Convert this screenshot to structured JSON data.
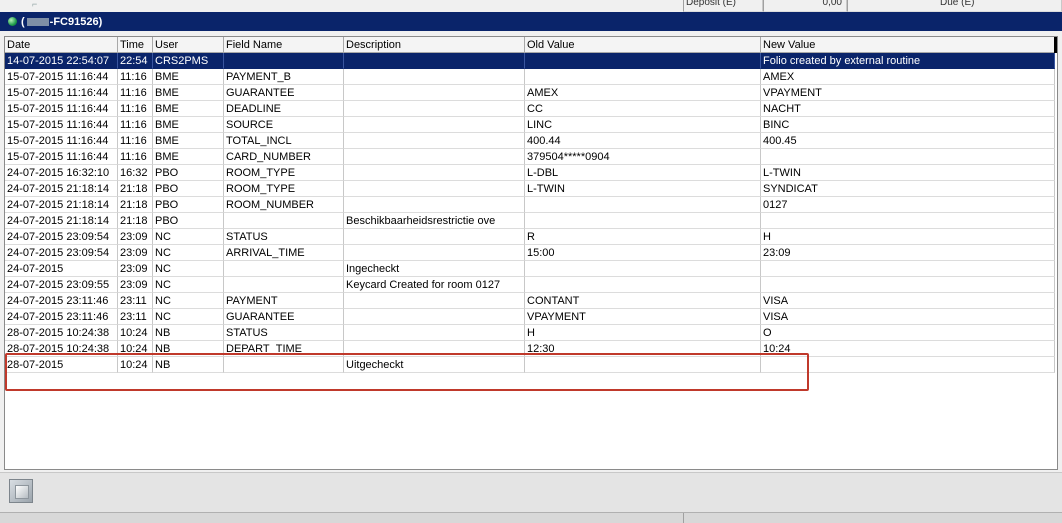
{
  "top_strip": {
    "cells": [
      "Deposit (E)",
      "0,00",
      "Due (E)"
    ]
  },
  "window": {
    "title_prefix": "(",
    "title_suffix": "-FC91526)"
  },
  "columns": {
    "date": "Date",
    "time": "Time",
    "user": "User",
    "field": "Field Name",
    "desc": "Description",
    "old": "Old Value",
    "new": "New Value"
  },
  "rows": [
    {
      "date": "14-07-2015 22:54:07",
      "time": "22:54",
      "user": "CRS2PMS",
      "field": "",
      "desc": "",
      "old": "",
      "new": "Folio created by external routine"
    },
    {
      "date": "15-07-2015 11:16:44",
      "time": "11:16",
      "user": "BME",
      "field": "PAYMENT_B",
      "desc": "",
      "old": "",
      "new": "AMEX"
    },
    {
      "date": "15-07-2015 11:16:44",
      "time": "11:16",
      "user": "BME",
      "field": "GUARANTEE",
      "desc": "",
      "old": "AMEX",
      "new": "VPAYMENT"
    },
    {
      "date": "15-07-2015 11:16:44",
      "time": "11:16",
      "user": "BME",
      "field": "DEADLINE",
      "desc": "",
      "old": "CC",
      "new": "NACHT"
    },
    {
      "date": "15-07-2015 11:16:44",
      "time": "11:16",
      "user": "BME",
      "field": "SOURCE",
      "desc": "",
      "old": "LINC",
      "new": "BINC"
    },
    {
      "date": "15-07-2015 11:16:44",
      "time": "11:16",
      "user": "BME",
      "field": "TOTAL_INCL",
      "desc": "",
      "old": "400.44",
      "new": "400.45"
    },
    {
      "date": "15-07-2015 11:16:44",
      "time": "11:16",
      "user": "BME",
      "field": "CARD_NUMBER",
      "desc": "",
      "old": "379504*****0904",
      "new": ""
    },
    {
      "date": "24-07-2015 16:32:10",
      "time": "16:32",
      "user": "PBO",
      "field": "ROOM_TYPE",
      "desc": "",
      "old": "L-DBL",
      "new": "L-TWIN"
    },
    {
      "date": "24-07-2015 21:18:14",
      "time": "21:18",
      "user": "PBO",
      "field": "ROOM_TYPE",
      "desc": "",
      "old": "L-TWIN",
      "new": "SYNDICAT"
    },
    {
      "date": "24-07-2015 21:18:14",
      "time": "21:18",
      "user": "PBO",
      "field": "ROOM_NUMBER",
      "desc": "",
      "old": "",
      "new": "0127"
    },
    {
      "date": "24-07-2015 21:18:14",
      "time": "21:18",
      "user": "PBO",
      "field": "",
      "desc": "Beschikbaarheidsrestrictie ove",
      "old": "",
      "new": ""
    },
    {
      "date": "24-07-2015 23:09:54",
      "time": "23:09",
      "user": "NC",
      "field": "STATUS",
      "desc": "",
      "old": "R",
      "new": "H"
    },
    {
      "date": "24-07-2015 23:09:54",
      "time": "23:09",
      "user": "NC",
      "field": "ARRIVAL_TIME",
      "desc": "",
      "old": "15:00",
      "new": "23:09"
    },
    {
      "date": "24-07-2015",
      "time": "23:09",
      "user": "NC",
      "field": "",
      "desc": "Ingecheckt",
      "old": "",
      "new": ""
    },
    {
      "date": "24-07-2015 23:09:55",
      "time": "23:09",
      "user": "NC",
      "field": "",
      "desc": "Keycard Created for room 0127",
      "old": "",
      "new": ""
    },
    {
      "date": "24-07-2015 23:11:46",
      "time": "23:11",
      "user": "NC",
      "field": "PAYMENT",
      "desc": "",
      "old": "CONTANT",
      "new": "VISA"
    },
    {
      "date": "24-07-2015 23:11:46",
      "time": "23:11",
      "user": "NC",
      "field": "GUARANTEE",
      "desc": "",
      "old": "VPAYMENT",
      "new": "VISA"
    },
    {
      "date": "28-07-2015 10:24:38",
      "time": "10:24",
      "user": "NB",
      "field": "STATUS",
      "desc": "",
      "old": "H",
      "new": "O"
    },
    {
      "date": "28-07-2015 10:24:38",
      "time": "10:24",
      "user": "NB",
      "field": "DEPART_TIME",
      "desc": "",
      "old": "12:30",
      "new": "10:24"
    },
    {
      "date": "28-07-2015",
      "time": "10:24",
      "user": "NB",
      "field": "",
      "desc": "Uitgecheckt",
      "old": "",
      "new": ""
    }
  ],
  "selected_row_index": 0,
  "highlighted_row_indices": [
    15,
    16
  ],
  "colors": {
    "title_bar": "#0a246a",
    "selection": "#0a246a",
    "highlight_border": "#c0392b"
  },
  "toolbar": {
    "icon": "window-icon"
  }
}
